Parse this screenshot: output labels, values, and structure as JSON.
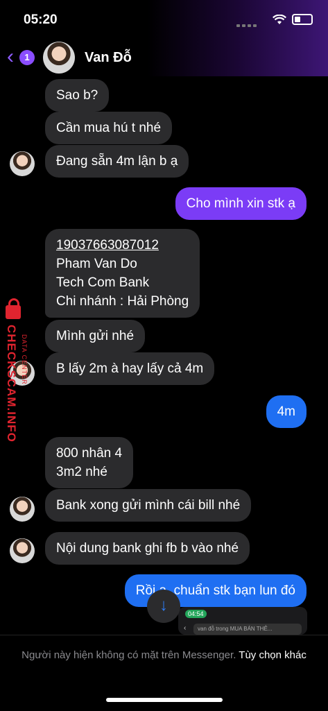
{
  "status": {
    "time": "05:20"
  },
  "header": {
    "back_badge": "1",
    "contact_name": "Van Đỗ"
  },
  "messages": [
    {
      "side": "in",
      "text": "Sao b?"
    },
    {
      "side": "in",
      "text": "Cần mua hú t nhé"
    },
    {
      "side": "in",
      "text": "Đang sẵn 4m lận b ạ"
    },
    {
      "side": "out",
      "text": "Cho mình xin stk ạ"
    },
    {
      "side": "in",
      "lines": [
        "19037663087012",
        "Pham Van Do",
        "Tech Com Bank",
        "Chi nhánh : Hải Phòng"
      ]
    },
    {
      "side": "in",
      "text": "Mình gửi nhé"
    },
    {
      "side": "in",
      "text": "B lấy 2m à hay lấy cả 4m"
    },
    {
      "side": "out",
      "text": "4m"
    },
    {
      "side": "in",
      "lines": [
        "800 nhân 4",
        "3m2 nhé"
      ]
    },
    {
      "side": "in",
      "text": "Bank xong gửi mình cái bill nhé"
    },
    {
      "side": "in",
      "text": "Nội dung bank ghi fb b vào nhé"
    },
    {
      "side": "out",
      "text": "Rồi ạ, chuẩn stk bạn lun đó"
    }
  ],
  "watermark": {
    "main": "CHECKSCAM.INFO",
    "sub": "DATA CENTER"
  },
  "thumbnail": {
    "time": "04:54",
    "search_text": "van đỗ trong MUA BÁN THẺ..."
  },
  "footer": {
    "notice": "Người này hiện không có mặt trên Messenger.",
    "link": "Tùy chọn khác"
  },
  "colors": {
    "incoming_bubble": "#2b2b2d",
    "outgoing_bubble": "#7b3cf6",
    "outgoing_blue": "#1f6ff2",
    "accent": "#8a4dff"
  }
}
